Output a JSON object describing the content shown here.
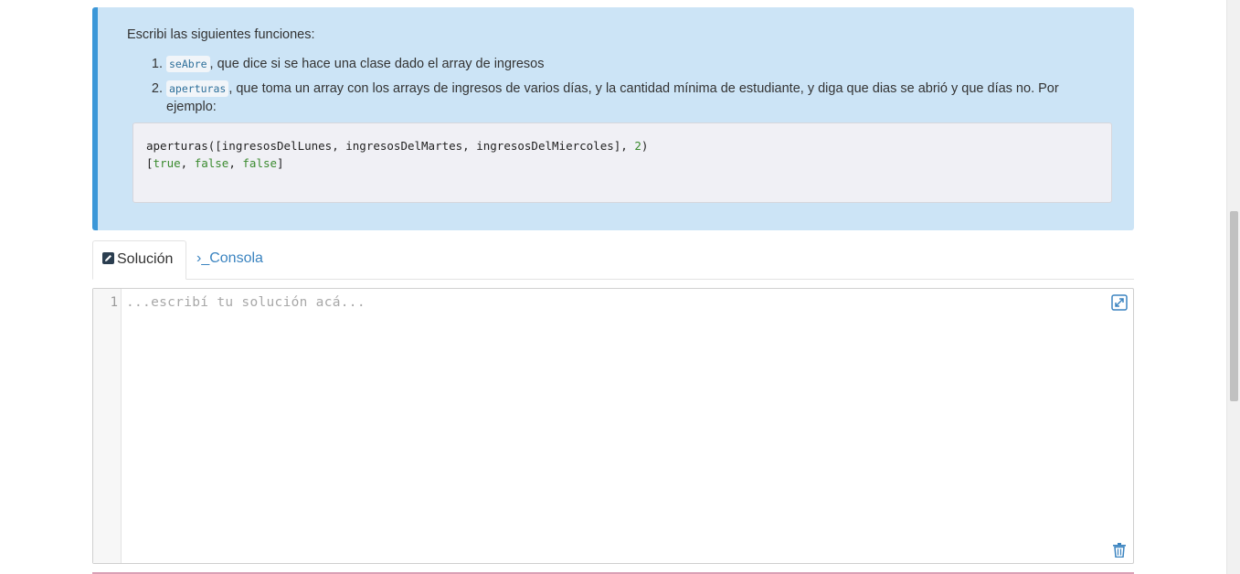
{
  "exercise": {
    "intro": "Escribi las siguientes funciones:",
    "items": [
      {
        "code": "seAbre",
        "text": ", que dice si se hace una clase dado el array de ingresos"
      },
      {
        "code": "aperturas",
        "text": ", que toma un array con los arrays de ingresos de varios días, y la cantidad mínima de estudiante, y diga que dias se abrió y que días no. Por ejemplo:"
      }
    ],
    "example": {
      "line1_call": "aperturas([ingresosDelLunes, ingresosDelMartes, ingresosDelMiercoles], ",
      "line1_num": "2",
      "line1_end": ")",
      "line2_open": "[",
      "line2_v1": "true",
      "line2_sep1": ", ",
      "line2_v2": "false",
      "line2_sep2": ", ",
      "line2_v3": "false",
      "line2_close": "]"
    }
  },
  "tabs": {
    "solucion": "Solución",
    "consola": "›_Consola"
  },
  "editor": {
    "line_number": "1",
    "placeholder": "...escribí tu solución acá..."
  },
  "icons": {
    "tab_solucion": "edit-icon",
    "expand": "expand-icon",
    "trash": "trash-icon"
  },
  "colors": {
    "callout_bg": "#cce4f6",
    "callout_border": "#3b97d8",
    "link": "#3b84c0"
  }
}
